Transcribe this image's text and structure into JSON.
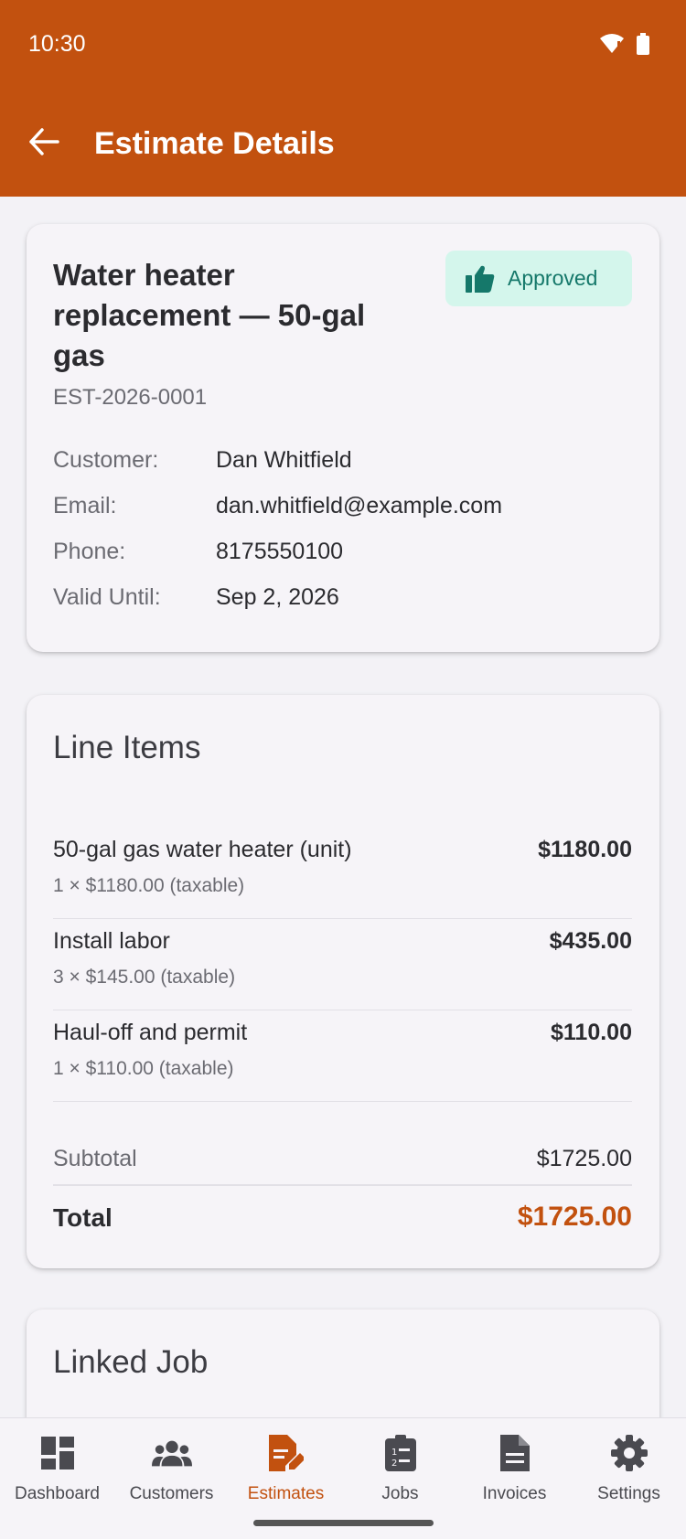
{
  "status_bar": {
    "time": "10:30"
  },
  "app_bar": {
    "title": "Estimate Details"
  },
  "estimate": {
    "title": "Water heater replacement — 50-gal gas",
    "number": "EST-2026-0001",
    "status": "Approved",
    "fields": [
      {
        "label": "Customer:",
        "value": "Dan Whitfield"
      },
      {
        "label": "Email:",
        "value": "dan.whitfield@example.com"
      },
      {
        "label": "Phone:",
        "value": "8175550100"
      },
      {
        "label": "Valid Until:",
        "value": "Sep 2, 2026"
      }
    ]
  },
  "line_items": {
    "title": "Line Items",
    "items": [
      {
        "description": "50-gal gas water heater (unit)",
        "detail": "1 × $1180.00 (taxable)",
        "amount": "$1180.00"
      },
      {
        "description": "Install labor",
        "detail": "3 × $145.00 (taxable)",
        "amount": "$435.00"
      },
      {
        "description": "Haul-off and permit",
        "detail": "1 × $110.00 (taxable)",
        "amount": "$110.00"
      }
    ],
    "subtotal_label": "Subtotal",
    "subtotal": "$1725.00",
    "total_label": "Total",
    "total": "$1725.00"
  },
  "linked_job": {
    "title": "Linked Job"
  },
  "bottom_nav": {
    "items": [
      {
        "label": "Dashboard",
        "icon": "dashboard-icon"
      },
      {
        "label": "Customers",
        "icon": "people-icon"
      },
      {
        "label": "Estimates",
        "icon": "estimate-edit-icon"
      },
      {
        "label": "Jobs",
        "icon": "clipboard-icon"
      },
      {
        "label": "Invoices",
        "icon": "document-icon"
      },
      {
        "label": "Settings",
        "icon": "gear-icon"
      }
    ],
    "active": "Estimates"
  },
  "colors": {
    "primary": "#c2510f",
    "badge_bg": "#d4f6ec",
    "badge_text": "#15786a",
    "background": "#f3f2f6"
  }
}
